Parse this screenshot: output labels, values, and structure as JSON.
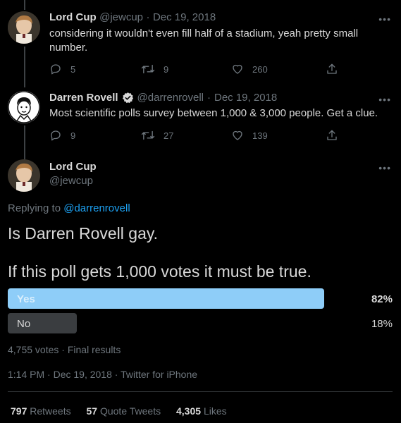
{
  "colors": {
    "background": "#000000",
    "text_primary": "#d9d9d9",
    "text_secondary": "#6e767d",
    "link": "#1da1f2",
    "poll_winner": "#8ecdf8",
    "poll_loser": "#3a3d40",
    "verified_badge": "#d9d9d9"
  },
  "reply1": {
    "name": "Lord Cup",
    "handle": "@jewcup",
    "separator": "·",
    "date": "Dec 19, 2018",
    "text": "considering it wouldn't even fill half of a stadium, yeah pretty small number.",
    "replies": "5",
    "retweets": "9",
    "likes": "260",
    "more_icon": "more-horizontal-icon"
  },
  "reply2": {
    "name": "Darren Rovell",
    "handle": "@darrenrovell",
    "separator": "·",
    "date": "Dec 19, 2018",
    "text": "Most scientific polls survey between 1,000 & 3,000 people. Get a clue.",
    "replies": "9",
    "retweets": "27",
    "likes": "139",
    "verified_icon": "verified-badge-icon"
  },
  "main_tweet": {
    "name": "Lord Cup",
    "handle": "@jewcup",
    "replying_prefix": "Replying to",
    "replying_to": "@darrenrovell",
    "line1": "Is Darren Rovell gay.",
    "line2": "If this poll gets 1,000 votes it must be true.",
    "poll": {
      "options": [
        {
          "label": "Yes",
          "percent_text": "82%",
          "percent": 82,
          "winner": true
        },
        {
          "label": "No",
          "percent_text": "18%",
          "percent": 18,
          "winner": false
        }
      ],
      "votes": "4,755 votes",
      "separator": "·",
      "status": "Final results"
    },
    "time": "1:14 PM",
    "date_sep": "·",
    "date": "Dec 19, 2018",
    "source_sep": "·",
    "source": "Twitter for iPhone",
    "stats": {
      "retweets_count": "797",
      "retweets_label": "Retweets",
      "quotes_count": "57",
      "quotes_label": "Quote Tweets",
      "likes_count": "4,305",
      "likes_label": "Likes"
    }
  }
}
